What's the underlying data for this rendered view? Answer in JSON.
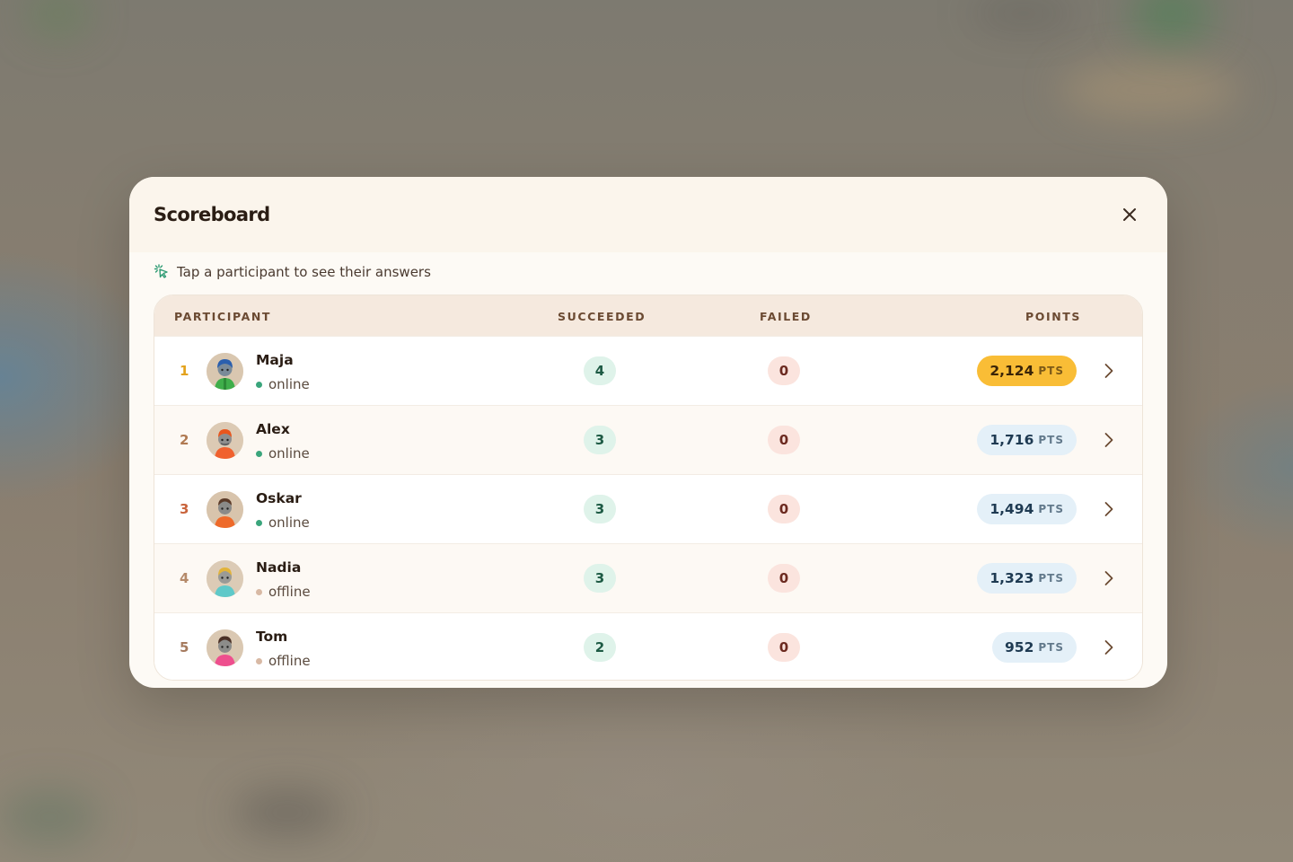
{
  "modal": {
    "title": "Scoreboard",
    "hint": "Tap a participant to see their answers"
  },
  "table": {
    "headers": {
      "participant": "PARTICIPANT",
      "succeeded": "SUCCEEDED",
      "failed": "FAILED",
      "points": "POINTS"
    },
    "points_unit": "PTS",
    "rows": [
      {
        "rank": "1",
        "name": "Maja",
        "status": "online",
        "succeeded": "4",
        "failed": "0",
        "points": "2,124"
      },
      {
        "rank": "2",
        "name": "Alex",
        "status": "online",
        "succeeded": "3",
        "failed": "0",
        "points": "1,716"
      },
      {
        "rank": "3",
        "name": "Oskar",
        "status": "online",
        "succeeded": "3",
        "failed": "0",
        "points": "1,494"
      },
      {
        "rank": "4",
        "name": "Nadia",
        "status": "offline",
        "succeeded": "3",
        "failed": "0",
        "points": "1,323"
      },
      {
        "rank": "5",
        "name": "Tom",
        "status": "offline",
        "succeeded": "2",
        "failed": "0",
        "points": "952"
      }
    ]
  },
  "colors": {
    "rank_1": "#e3a21c",
    "rank_2": "#b07a52",
    "rank_3": "#c9643c",
    "rank_4": "#b58a6a",
    "rank_5": "#a57a5e",
    "gold_pill": "#f9bd36",
    "blue_pill": "#e4f0f8",
    "online": "#3aa57c",
    "offline": "#d8b9a4"
  },
  "icons": {
    "close": "close-icon",
    "hint": "tap-sparkle-icon",
    "row_action": "chevron-right-icon"
  }
}
